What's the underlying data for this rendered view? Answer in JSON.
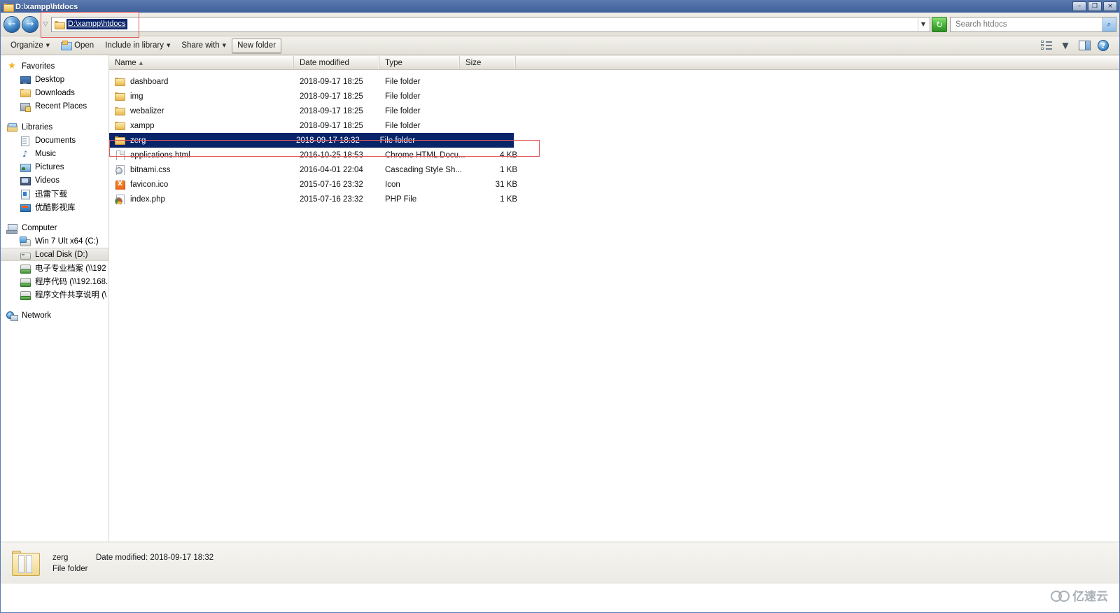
{
  "window": {
    "title": "D:\\xampp\\htdocs",
    "title_icon": "folder-icon",
    "minimize": "–",
    "restore": "❐",
    "close": "×"
  },
  "address_bar": {
    "back_icon": "←",
    "forward_icon": "→",
    "recent_dropdown_icon": "▽",
    "path_value": "D:\\xampp\\htdocs",
    "path_dropdown_icon": "▼",
    "refresh_icon": "↻",
    "search_placeholder": "Search htdocs",
    "search_value": "",
    "search_icon": "⌕"
  },
  "command_bar": {
    "items": [
      {
        "label": "Organize",
        "caret": "▼",
        "icon": "",
        "framed": false
      },
      {
        "label": "Open",
        "caret": "",
        "icon": "open-folder-icon",
        "framed": false
      },
      {
        "label": "Include in library",
        "caret": "▼",
        "icon": "",
        "framed": false
      },
      {
        "label": "Share with",
        "caret": "▼",
        "icon": "",
        "framed": false
      },
      {
        "label": "New folder",
        "caret": "",
        "icon": "",
        "framed": true
      }
    ],
    "right_icons": [
      {
        "name": "change-view-icon",
        "glyph": ""
      },
      {
        "name": "change-view-dropdown-icon",
        "glyph": "▼"
      },
      {
        "name": "preview-pane-icon",
        "glyph": ""
      },
      {
        "name": "help-icon",
        "glyph": "?"
      }
    ]
  },
  "sidebar": {
    "groups": [
      {
        "name": "favorites",
        "root": {
          "label": "Favorites",
          "icon": "star-icon"
        },
        "children": [
          {
            "label": "Desktop",
            "icon": "desktop-icon"
          },
          {
            "label": "Downloads",
            "icon": "folder-icon"
          },
          {
            "label": "Recent Places",
            "icon": "recent-places-icon"
          }
        ]
      },
      {
        "name": "libraries",
        "root": {
          "label": "Libraries",
          "icon": "libraries-icon"
        },
        "children": [
          {
            "label": "Documents",
            "icon": "documents-icon"
          },
          {
            "label": "Music",
            "icon": "music-icon"
          },
          {
            "label": "Pictures",
            "icon": "pictures-icon"
          },
          {
            "label": "Videos",
            "icon": "videos-icon"
          },
          {
            "label": "迅雷下载",
            "icon": "thunder-download-icon"
          },
          {
            "label": "优酷影视库",
            "icon": "youku-library-icon"
          }
        ]
      },
      {
        "name": "computer",
        "root": {
          "label": "Computer",
          "icon": "computer-icon"
        },
        "children": [
          {
            "label": "Win 7 Ult x64 (C:)",
            "icon": "windows-drive-icon",
            "selected": false
          },
          {
            "label": "Local Disk (D:)",
            "icon": "hard-drive-icon",
            "selected": true
          },
          {
            "label": "电子专业档案 (\\\\192",
            "icon": "network-drive-icon",
            "selected": false
          },
          {
            "label": "程序代码 (\\\\192.168.",
            "icon": "network-drive-icon",
            "selected": false
          },
          {
            "label": "程序文件共享说明 (\\",
            "icon": "network-drive-icon",
            "selected": false
          }
        ]
      },
      {
        "name": "network",
        "root": {
          "label": "Network",
          "icon": "network-icon"
        },
        "children": []
      }
    ]
  },
  "file_list": {
    "columns": [
      {
        "key": "name",
        "label": "Name",
        "sort": "▲"
      },
      {
        "key": "date",
        "label": "Date modified",
        "sort": ""
      },
      {
        "key": "type",
        "label": "Type",
        "sort": ""
      },
      {
        "key": "size",
        "label": "Size",
        "sort": ""
      }
    ],
    "rows": [
      {
        "name": "dashboard",
        "date": "2018-09-17 18:25",
        "type": "File folder",
        "size": "",
        "icon": "folder-icon",
        "selected": false
      },
      {
        "name": "img",
        "date": "2018-09-17 18:25",
        "type": "File folder",
        "size": "",
        "icon": "folder-icon",
        "selected": false
      },
      {
        "name": "webalizer",
        "date": "2018-09-17 18:25",
        "type": "File folder",
        "size": "",
        "icon": "folder-icon",
        "selected": false
      },
      {
        "name": "xampp",
        "date": "2018-09-17 18:25",
        "type": "File folder",
        "size": "",
        "icon": "folder-icon",
        "selected": false
      },
      {
        "name": "zerg",
        "date": "2018-09-17 18:32",
        "type": "File folder",
        "size": "",
        "icon": "folder-icon",
        "selected": true
      },
      {
        "name": "applications.html",
        "date": "2016-10-25 18:53",
        "type": "Chrome HTML Docu...",
        "size": "4 KB",
        "icon": "html-file-icon",
        "selected": false
      },
      {
        "name": "bitnami.css",
        "date": "2016-04-01 22:04",
        "type": "Cascading Style Sh...",
        "size": "1 KB",
        "icon": "css-file-icon",
        "selected": false
      },
      {
        "name": "favicon.ico",
        "date": "2015-07-16 23:32",
        "type": "Icon",
        "size": "31 KB",
        "icon": "ico-file-icon",
        "selected": false
      },
      {
        "name": "index.php",
        "date": "2015-07-16 23:32",
        "type": "PHP File",
        "size": "1 KB",
        "icon": "php-file-icon",
        "selected": false
      }
    ]
  },
  "details_pane": {
    "icon": "folder-large-icon",
    "name": "zerg",
    "date_label": "Date modified: 2018-09-17 18:32",
    "type": "File folder"
  },
  "watermark": {
    "text": "亿速云",
    "logo": "cloud-logo-icon"
  },
  "colors": {
    "selection": "#0a246a",
    "annotation": "#e2585c",
    "titlebar": "#4a6aa3",
    "toolbar": "#e4e1d9"
  }
}
